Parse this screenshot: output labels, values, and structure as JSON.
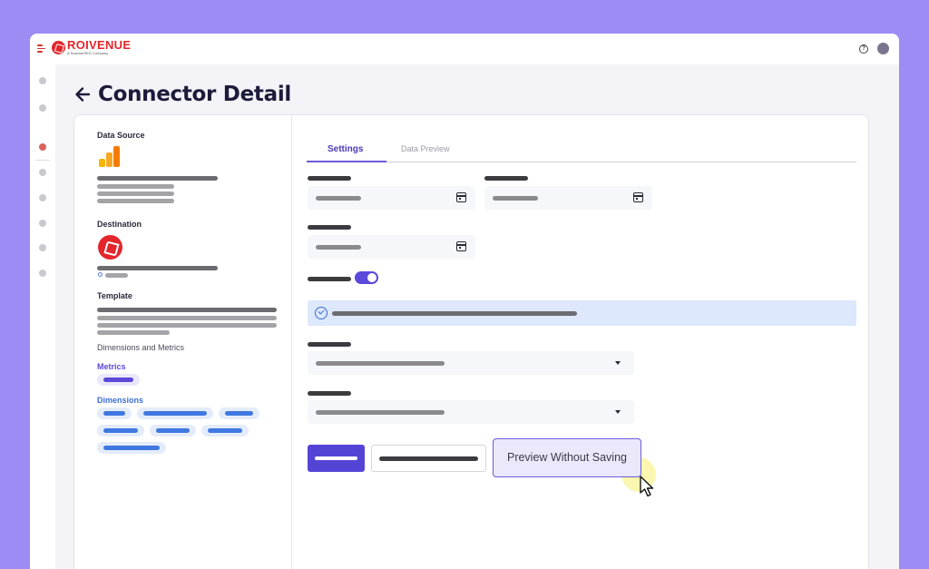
{
  "brand": {
    "name": "ROIVENUE",
    "subtitle": "A ScannerSEO Company",
    "accent_color": "#e3262b",
    "primary_color": "#5444d6"
  },
  "header": {
    "menu_icon": "menu-icon",
    "help_icon": "help-circle-icon",
    "help_glyph": "?",
    "avatar": "user-avatar"
  },
  "page": {
    "back_icon": "arrow-left-icon",
    "title": "Connector Detail"
  },
  "left_panel": {
    "data_source_label": "Data Source",
    "data_source_icon": "google-analytics-icon",
    "destination_label": "Destination",
    "destination_icon": "roivenue-logo-icon",
    "template_label": "Template",
    "dimensions_metrics_label": "Dimensions and Metrics",
    "metrics_label": "Metrics",
    "dimensions_label": "Dimensions"
  },
  "tabs": [
    {
      "label": "Settings",
      "active": true
    },
    {
      "label": "Data Preview",
      "active": false
    }
  ],
  "form": {
    "toggle_on": true,
    "info_icon": "check-circle-icon",
    "calendar_icon": "calendar-icon",
    "dropdown_icon": "caret-down-icon"
  },
  "actions": {
    "preview_button_label": "Preview Without Saving"
  }
}
